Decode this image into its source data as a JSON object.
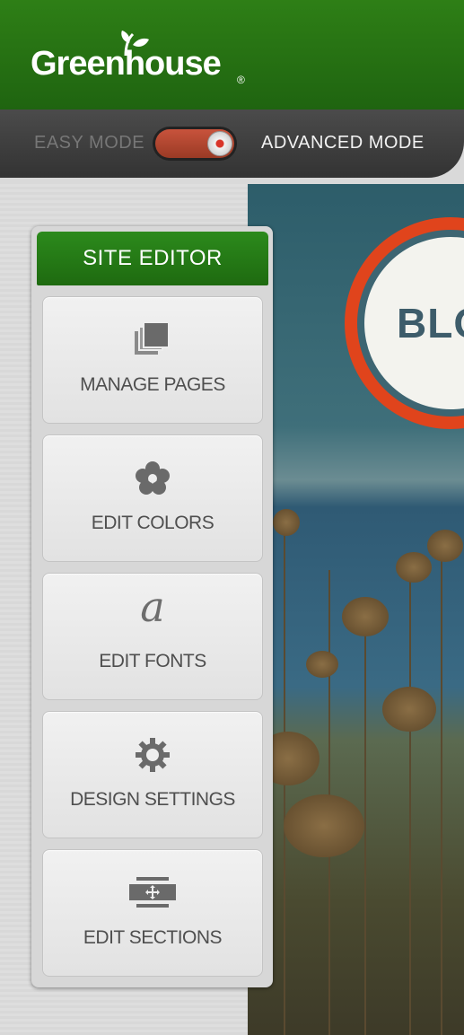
{
  "app": {
    "brand": "Greenhouse",
    "brand_mark": "®"
  },
  "mode_bar": {
    "easy_label": "EASY MODE",
    "advanced_label": "ADVANCED MODE",
    "toggle_state": "advanced"
  },
  "panel": {
    "title": "SITE EDITOR",
    "items": [
      {
        "label": "MANAGE PAGES",
        "icon": "pages-stack-icon"
      },
      {
        "label": "EDIT COLORS",
        "icon": "flower-color-icon"
      },
      {
        "label": "EDIT FONTS",
        "icon": "font-a-icon",
        "glyph": "a"
      },
      {
        "label": "DESIGN SETTINGS",
        "icon": "gear-icon"
      },
      {
        "label": "EDIT SECTIONS",
        "icon": "sections-move-icon"
      }
    ]
  },
  "preview": {
    "badge_text": "BLOG"
  },
  "colors": {
    "brand_green": "#2e7f16",
    "toggle_red": "#c8533c",
    "badge_orange": "#e0441c"
  }
}
